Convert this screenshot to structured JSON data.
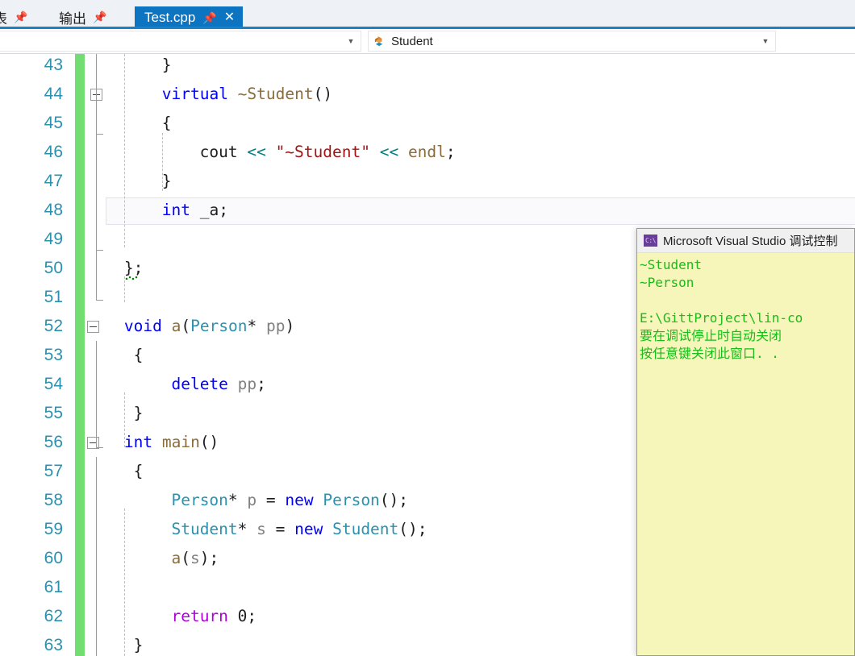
{
  "tabstrip": {
    "docwell_items": [
      {
        "label": "表",
        "pin_icon": "pin-icon"
      },
      {
        "label": "输出",
        "pin_icon": "pin-icon"
      }
    ],
    "active_tab": {
      "label": "Test.cpp",
      "pin_icon": "pin-icon",
      "close_icon": "close-icon",
      "background": "#0d74c2"
    },
    "underline_color": "#1a81c8"
  },
  "navbar": {
    "left_combo": {
      "value": "",
      "arrow_icon": "chevron-down-icon"
    },
    "right_combo": {
      "value": "Student",
      "icon": "class-icon",
      "arrow_icon": "chevron-down-icon"
    }
  },
  "editor": {
    "line_number_color": "#2b91af",
    "change_bar_color": "#72de72",
    "current_line": 48,
    "lines": [
      {
        "num": 43,
        "indent": 8,
        "tokens": [
          {
            "t": "}",
            "c": "k-plain"
          }
        ]
      },
      {
        "num": 44,
        "indent": 8,
        "collapse": true,
        "tokens": [
          {
            "t": "virtual ",
            "c": "k-kw"
          },
          {
            "t": "~Student",
            "c": "k-fn"
          },
          {
            "t": "()",
            "c": "k-plain"
          }
        ]
      },
      {
        "num": 45,
        "indent": 8,
        "tokens": [
          {
            "t": "{",
            "c": "k-plain"
          }
        ]
      },
      {
        "num": 46,
        "indent": 12,
        "tokens": [
          {
            "t": "cout ",
            "c": "k-plain"
          },
          {
            "t": "<< ",
            "c": "k-op"
          },
          {
            "t": "\"~Student\"",
            "c": "k-str"
          },
          {
            "t": " << ",
            "c": "k-op"
          },
          {
            "t": "endl",
            "c": "k-type"
          },
          {
            "t": ";",
            "c": "k-plain"
          }
        ]
      },
      {
        "num": 47,
        "indent": 8,
        "tokens": [
          {
            "t": "}",
            "c": "k-plain"
          }
        ]
      },
      {
        "num": 48,
        "indent": 8,
        "tokens": [
          {
            "t": "int ",
            "c": "k-kw"
          },
          {
            "t": "_a;",
            "c": "k-plain"
          }
        ]
      },
      {
        "num": 49,
        "indent": 0,
        "tokens": []
      },
      {
        "num": 50,
        "indent": 4,
        "squiggle": true,
        "tokens": [
          {
            "t": "};",
            "c": "k-plain"
          }
        ]
      },
      {
        "num": 51,
        "indent": 0,
        "tokens": []
      },
      {
        "num": 52,
        "indent": 4,
        "collapse": true,
        "tokens": [
          {
            "t": "void ",
            "c": "k-kw"
          },
          {
            "t": "a",
            "c": "k-fn"
          },
          {
            "t": "(",
            "c": "k-plain"
          },
          {
            "t": "Person",
            "c": "k-class"
          },
          {
            "t": "* ",
            "c": "k-plain"
          },
          {
            "t": "pp",
            "c": "k-var"
          },
          {
            "t": ")",
            "c": "k-plain"
          }
        ]
      },
      {
        "num": 53,
        "indent": 5,
        "tokens": [
          {
            "t": "{",
            "c": "k-plain"
          }
        ]
      },
      {
        "num": 54,
        "indent": 9,
        "tokens": [
          {
            "t": "delete ",
            "c": "k-kw"
          },
          {
            "t": "pp",
            "c": "k-var"
          },
          {
            "t": ";",
            "c": "k-plain"
          }
        ]
      },
      {
        "num": 55,
        "indent": 5,
        "tokens": [
          {
            "t": "}",
            "c": "k-plain"
          }
        ]
      },
      {
        "num": 56,
        "indent": 4,
        "collapse": true,
        "tokens": [
          {
            "t": "int ",
            "c": "k-kw"
          },
          {
            "t": "main",
            "c": "k-fn"
          },
          {
            "t": "()",
            "c": "k-plain"
          }
        ]
      },
      {
        "num": 57,
        "indent": 5,
        "tokens": [
          {
            "t": "{",
            "c": "k-plain"
          }
        ]
      },
      {
        "num": 58,
        "indent": 9,
        "tokens": [
          {
            "t": "Person",
            "c": "k-class"
          },
          {
            "t": "* ",
            "c": "k-plain"
          },
          {
            "t": "p",
            "c": "k-var"
          },
          {
            "t": " = ",
            "c": "k-plain"
          },
          {
            "t": "new ",
            "c": "k-kw"
          },
          {
            "t": "Person",
            "c": "k-class"
          },
          {
            "t": "();",
            "c": "k-plain"
          }
        ]
      },
      {
        "num": 59,
        "indent": 9,
        "tokens": [
          {
            "t": "Student",
            "c": "k-class"
          },
          {
            "t": "* ",
            "c": "k-plain"
          },
          {
            "t": "s",
            "c": "k-var"
          },
          {
            "t": " = ",
            "c": "k-plain"
          },
          {
            "t": "new ",
            "c": "k-kw"
          },
          {
            "t": "Student",
            "c": "k-class"
          },
          {
            "t": "();",
            "c": "k-plain"
          }
        ]
      },
      {
        "num": 60,
        "indent": 9,
        "tokens": [
          {
            "t": "a",
            "c": "k-fn"
          },
          {
            "t": "(",
            "c": "k-plain"
          },
          {
            "t": "s",
            "c": "k-var"
          },
          {
            "t": ");",
            "c": "k-plain"
          }
        ]
      },
      {
        "num": 61,
        "indent": 0,
        "tokens": []
      },
      {
        "num": 62,
        "indent": 9,
        "tokens": [
          {
            "t": "return ",
            "c": "k-ret"
          },
          {
            "t": "0;",
            "c": "k-num"
          }
        ]
      },
      {
        "num": 63,
        "indent": 5,
        "tokens": [
          {
            "t": "}",
            "c": "k-plain"
          }
        ]
      }
    ]
  },
  "console": {
    "title": "Microsoft Visual Studio 调试控制",
    "app_icon": "console-icon",
    "background": "#f6f6bb",
    "text_color": "#1abc1a",
    "lines": [
      "~Student",
      "~Person",
      "",
      "E:\\GittProject\\lin-co",
      "要在调试停止时自动关闭",
      "按任意键关闭此窗口. ."
    ]
  }
}
